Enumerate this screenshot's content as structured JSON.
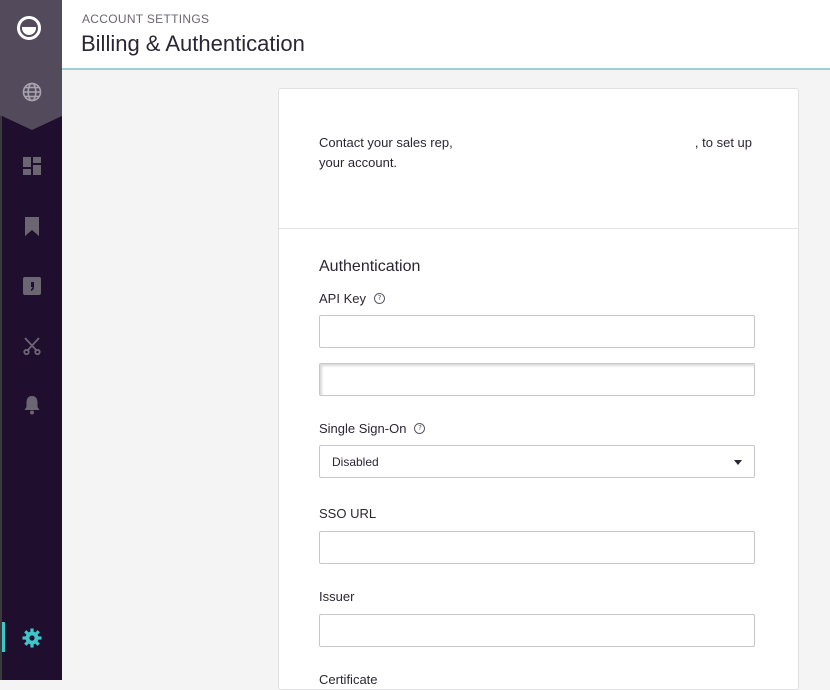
{
  "header": {
    "breadcrumb": "ACCOUNT SETTINGS",
    "title": "Billing & Authentication"
  },
  "sidebar": {
    "items": [
      {
        "name": "globe",
        "icon": "globe-icon"
      },
      {
        "name": "dashboard",
        "icon": "dashboard-icon"
      },
      {
        "name": "bookmarks",
        "icon": "bookmark-icon"
      },
      {
        "name": "quotes",
        "icon": "quote-icon"
      },
      {
        "name": "clippings",
        "icon": "scissors-icon"
      },
      {
        "name": "alerts",
        "icon": "bell-icon"
      },
      {
        "name": "settings",
        "icon": "gear-icon",
        "active": true
      }
    ],
    "active_color": "#3ec7c8"
  },
  "billing": {
    "contact_before": "Contact your sales rep, ",
    "contact_after": " , to set up your account."
  },
  "auth": {
    "section_title": "Authentication",
    "api_key_label": "API Key",
    "api_key_value_1": "",
    "api_key_value_2": "",
    "sso_label": "Single Sign-On",
    "sso_selected": "Disabled",
    "sso_url_label": "SSO URL",
    "sso_url_value": "",
    "issuer_label": "Issuer",
    "issuer_value": "",
    "certificate_label": "Certificate"
  }
}
